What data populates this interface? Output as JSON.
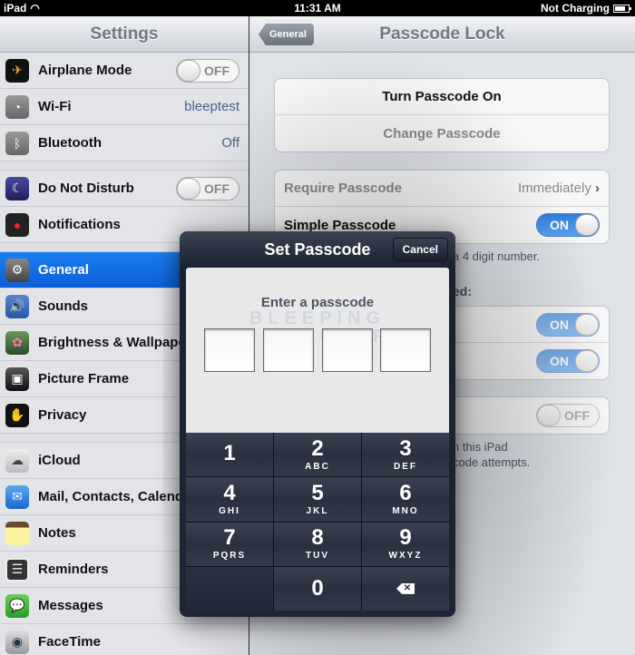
{
  "status_bar": {
    "device": "iPad",
    "time": "11:31 AM",
    "battery_text": "Not Charging"
  },
  "left_pane": {
    "title": "Settings",
    "items": [
      {
        "label": "Airplane Mode",
        "icon": "airplane-icon",
        "switch": "OFF"
      },
      {
        "label": "Wi-Fi",
        "icon": "wifi-icon",
        "value": "bleeptest"
      },
      {
        "label": "Bluetooth",
        "icon": "bluetooth-icon",
        "value": "Off"
      },
      {
        "label": "Do Not Disturb",
        "icon": "moon-icon",
        "switch": "OFF"
      },
      {
        "label": "Notifications",
        "icon": "notifications-icon"
      },
      {
        "label": "General",
        "icon": "gear-icon",
        "selected": true
      },
      {
        "label": "Sounds",
        "icon": "speaker-icon"
      },
      {
        "label": "Brightness & Wallpaper",
        "icon": "flower-icon"
      },
      {
        "label": "Picture Frame",
        "icon": "picture-frame-icon"
      },
      {
        "label": "Privacy",
        "icon": "hand-icon"
      },
      {
        "label": "iCloud",
        "icon": "cloud-icon"
      },
      {
        "label": "Mail, Contacts, Calendars",
        "icon": "mail-icon"
      },
      {
        "label": "Notes",
        "icon": "notes-icon"
      },
      {
        "label": "Reminders",
        "icon": "reminders-icon"
      },
      {
        "label": "Messages",
        "icon": "messages-icon"
      },
      {
        "label": "FaceTime",
        "icon": "facetime-icon"
      }
    ]
  },
  "right_pane": {
    "back_label": "General",
    "title": "Passcode Lock",
    "turn_on": "Turn Passcode On",
    "change": "Change Passcode",
    "require_label": "Require Passcode",
    "require_value": "Immediately",
    "simple_label": "Simple Passcode",
    "simple_switch": "ON",
    "simple_note_tail": "a 4 digit number.",
    "allow_section_tail": "ed:",
    "allow_switch_1": "ON",
    "allow_switch_2": "ON",
    "erase_switch": "OFF",
    "erase_note_1": "n this iPad",
    "erase_note_2": "code attempts."
  },
  "dialog": {
    "title": "Set Passcode",
    "cancel": "Cancel",
    "prompt": "Enter a passcode",
    "watermark_1": "BLEEPING",
    "watermark_2": "COMPUTER",
    "keys": [
      {
        "n": "1",
        "s": ""
      },
      {
        "n": "2",
        "s": "ABC"
      },
      {
        "n": "3",
        "s": "DEF"
      },
      {
        "n": "4",
        "s": "GHI"
      },
      {
        "n": "5",
        "s": "JKL"
      },
      {
        "n": "6",
        "s": "MNO"
      },
      {
        "n": "7",
        "s": "PQRS"
      },
      {
        "n": "8",
        "s": "TUV"
      },
      {
        "n": "9",
        "s": "WXYZ"
      },
      {
        "n": "",
        "s": ""
      },
      {
        "n": "0",
        "s": ""
      },
      {
        "n": "delete",
        "s": ""
      }
    ]
  }
}
